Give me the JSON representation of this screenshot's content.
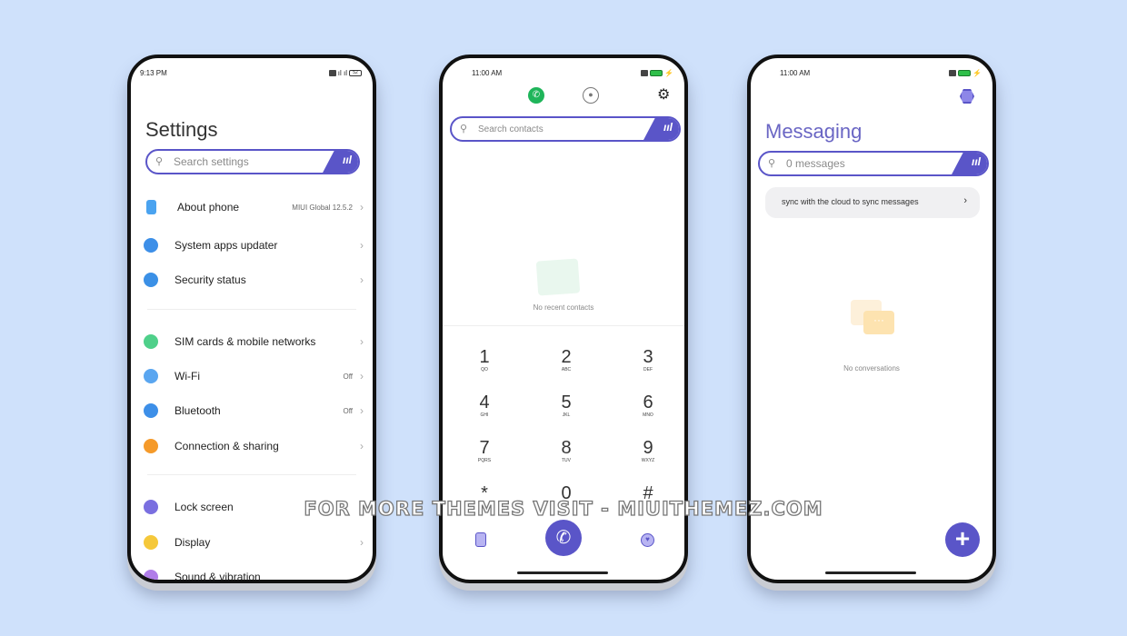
{
  "settings": {
    "time": "9:13 PM",
    "battery": "52",
    "title": "Settings",
    "search_placeholder": "Search settings",
    "items": [
      {
        "label": "About phone",
        "value": "MIUI Global 12.5.2",
        "icon": "phone-icon",
        "color": "#4aa3f0"
      },
      {
        "label": "System apps updater",
        "value": "",
        "icon": "arrow-up-icon",
        "color": "#3d8fe8"
      },
      {
        "label": "Security status",
        "value": "",
        "icon": "shield-icon",
        "color": "#3b90e6"
      },
      {
        "label": "SIM cards & mobile networks",
        "value": "",
        "icon": "sim-icon",
        "color": "#4fd08a"
      },
      {
        "label": "Wi-Fi",
        "value": "Off",
        "icon": "wifi-icon",
        "color": "#5aa6f0"
      },
      {
        "label": "Bluetooth",
        "value": "Off",
        "icon": "bluetooth-icon",
        "color": "#3d8fe8"
      },
      {
        "label": "Connection & sharing",
        "value": "",
        "icon": "connection-icon",
        "color": "#f59a2a"
      },
      {
        "label": "Lock screen",
        "value": "",
        "icon": "lock-icon",
        "color": "#7a6fe0"
      },
      {
        "label": "Display",
        "value": "",
        "icon": "display-icon",
        "color": "#f5c83a"
      },
      {
        "label": "Sound & vibration",
        "value": "",
        "icon": "sound-icon",
        "color": "#b07de8"
      }
    ]
  },
  "dialer": {
    "time": "11:00 AM",
    "battery": "100",
    "search_placeholder": "Search contacts",
    "empty": "No recent contacts",
    "keys": [
      {
        "d": "1",
        "l": "QO"
      },
      {
        "d": "2",
        "l": "ABC"
      },
      {
        "d": "3",
        "l": "DEF"
      },
      {
        "d": "4",
        "l": "GHI"
      },
      {
        "d": "5",
        "l": "JKL"
      },
      {
        "d": "6",
        "l": "MNO"
      },
      {
        "d": "7",
        "l": "PQRS"
      },
      {
        "d": "8",
        "l": "TUV"
      },
      {
        "d": "9",
        "l": "WXYZ"
      },
      {
        "d": "*",
        "l": ""
      },
      {
        "d": "0",
        "l": "+"
      },
      {
        "d": "#",
        "l": ""
      }
    ]
  },
  "messaging": {
    "time": "11:00 AM",
    "battery": "100",
    "title": "Messaging",
    "search_placeholder": "0 messages",
    "sync_banner": "sync with the cloud to sync messages",
    "empty": "No conversations"
  },
  "accent": "#5a55c8",
  "watermark": "FOR MORE THEMES VISIT - MIUITHEMEZ.COM"
}
